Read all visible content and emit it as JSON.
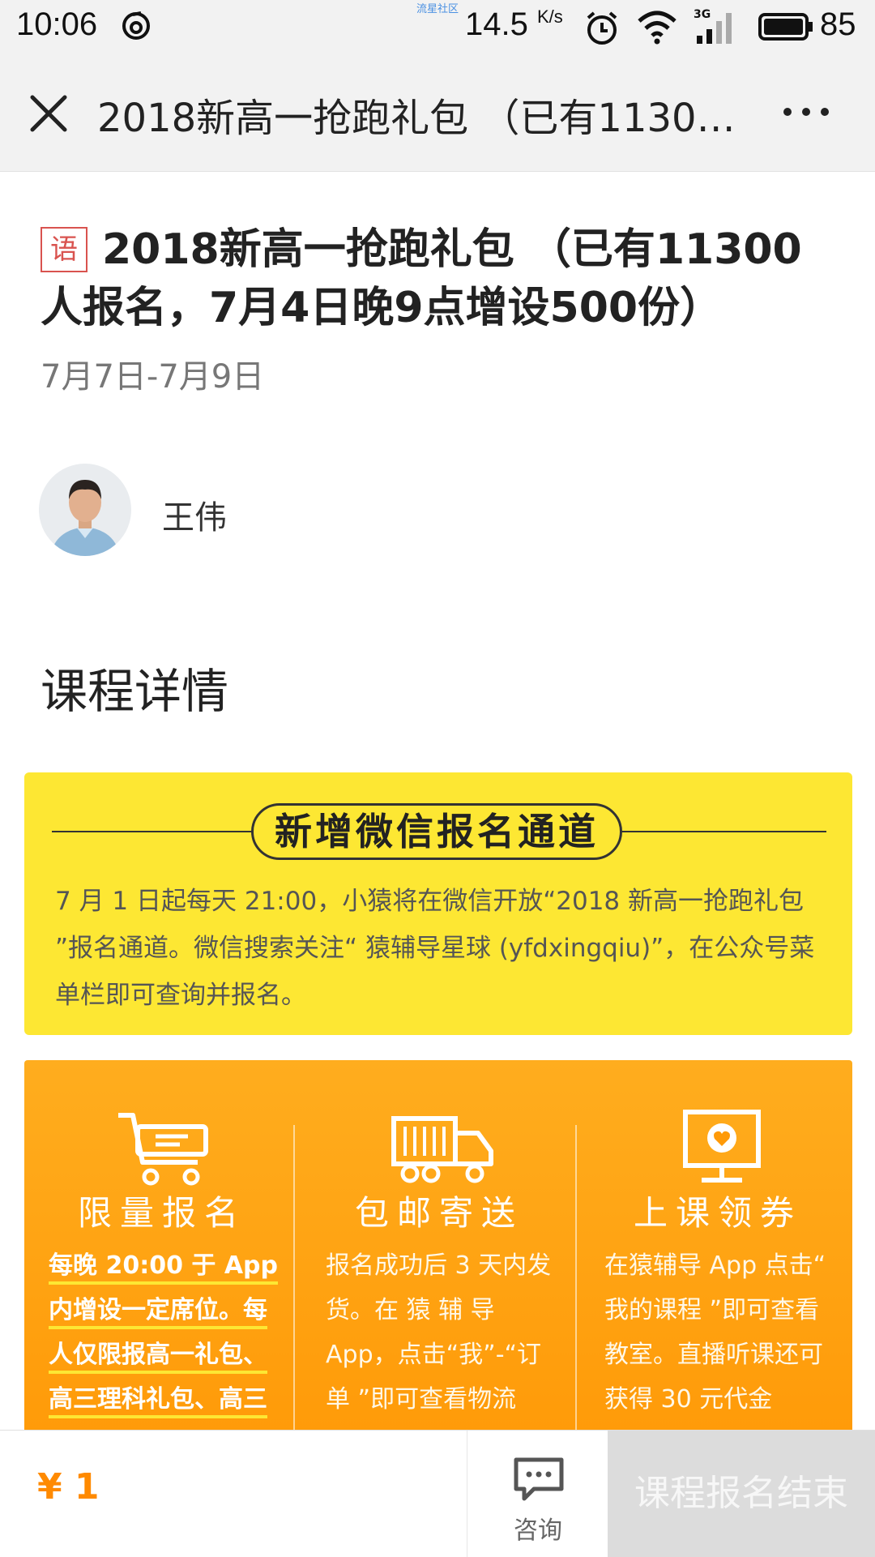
{
  "status_bar": {
    "time": "10:06",
    "watermark": "流星社区",
    "net_speed": "14.5",
    "net_unit": "K/s",
    "network_type": "3G",
    "battery": "85"
  },
  "nav": {
    "title": "2018新高一抢跑礼包 （已有1130…",
    "close_icon": "close-icon",
    "more_icon": "more-icon"
  },
  "course": {
    "subject_badge": "语",
    "title": "2018新高一抢跑礼包 （已有11300人报名，7月4日晚9点增设500份）",
    "date": "7月7日-7月9日",
    "teacher": "王伟"
  },
  "section_title": "课程详情",
  "notice": {
    "heading": "新增微信报名通道",
    "body": "7 月 1 日起每天 21:00，小猿将在微信开放“2018 新高一抢跑礼包 ”报名通道。微信搜索关注“ 猿辅导星球 (yfdxingqiu)”，在公众号菜单栏即可查询并报名。"
  },
  "features": [
    {
      "icon": "shopping-cart-icon",
      "title": "限量报名",
      "text": "每晚 20:00 于 App 内增设一定席位。每人仅限报高一礼包、高三理科礼包、高三"
    },
    {
      "icon": "delivery-truck-icon",
      "title": "包邮寄送",
      "text": "报名成功后 3 天内发 货。在 猿 辅 导 App，点击“我”-“订 单 ”即可查看物流"
    },
    {
      "icon": "monitor-heart-icon",
      "title": "上课领券",
      "text": "在猿辅导 App 点击“ 我的课程 ”即可查看教室。直播听课还可获得 30 元代金"
    }
  ],
  "bottom": {
    "price": "¥ 1",
    "consult_label": "咨询",
    "signup_label": "课程报名结束"
  },
  "colors": {
    "notice_bg": "#fde733",
    "features_bg": "#ff9a08",
    "price": "#ff8a00",
    "badge": "#d9534f"
  }
}
